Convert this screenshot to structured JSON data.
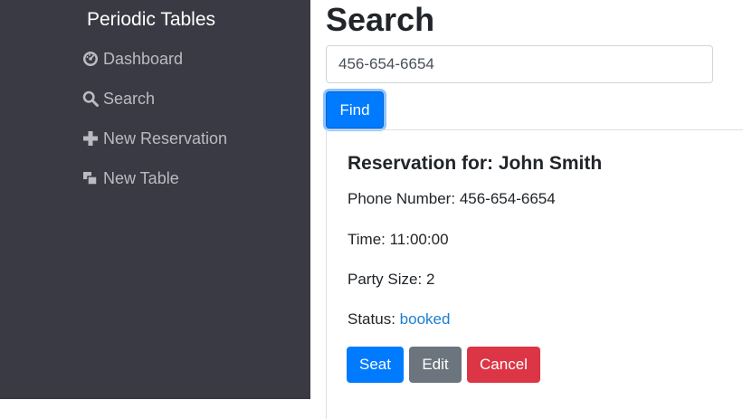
{
  "sidebar": {
    "brand": "Periodic Tables",
    "items": [
      {
        "label": "Dashboard",
        "icon": "dashboard-icon"
      },
      {
        "label": "Search",
        "icon": "search-icon"
      },
      {
        "label": "New Reservation",
        "icon": "plus-icon"
      },
      {
        "label": "New Table",
        "icon": "table-icon"
      }
    ]
  },
  "main": {
    "title": "Search",
    "search": {
      "value": "456-654-6654"
    },
    "find_label": "Find"
  },
  "reservation": {
    "title": "Reservation for: John Smith",
    "phone_label": "Phone Number:",
    "phone": "456-654-6654",
    "time_label": "Time:",
    "time": "11:00:00",
    "party_label": "Party Size:",
    "party": "2",
    "status_label": "Status:",
    "status": "booked",
    "seat_label": "Seat",
    "edit_label": "Edit",
    "cancel_label": "Cancel"
  },
  "colors": {
    "sidebar_bg": "#3a3a44",
    "primary": "#007bff",
    "secondary": "#6c757d",
    "danger": "#dc3545",
    "status_link": "#1a7fd4"
  }
}
